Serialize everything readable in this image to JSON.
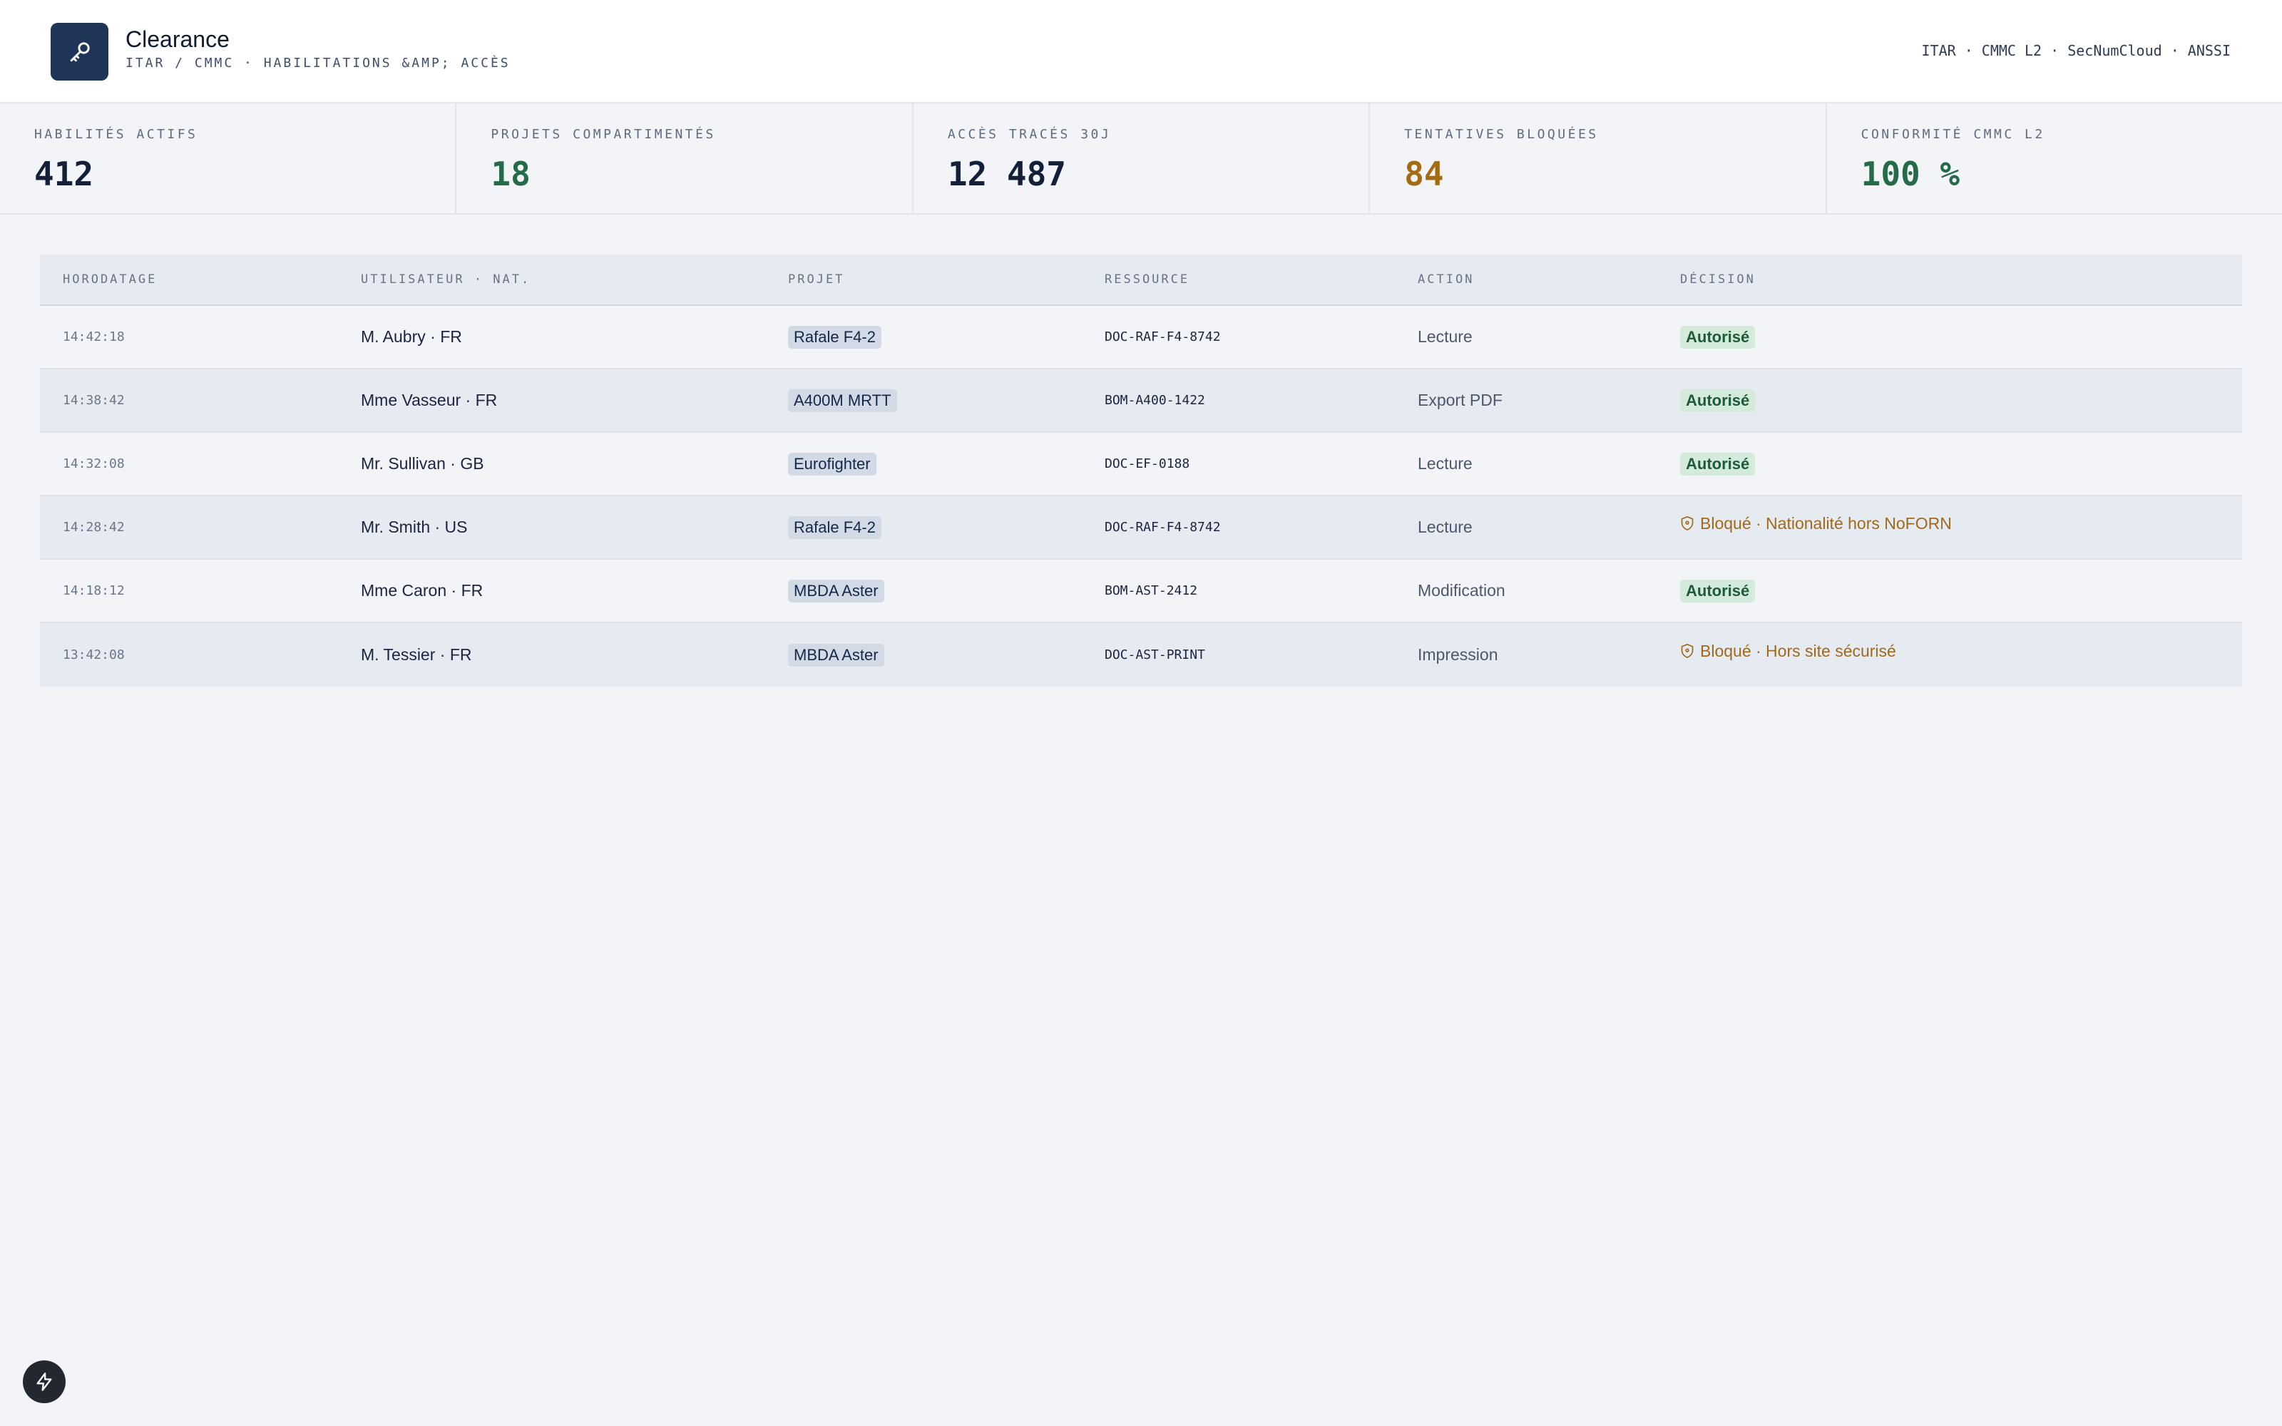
{
  "header": {
    "logo_icon": "key-icon",
    "title": "Clearance",
    "subtitle": "ITAR / CMMC · HABILITATIONS &AMP; ACCÈS",
    "compliance": "ITAR · CMMC L2 · SecNumCloud · ANSSI"
  },
  "kpis": [
    {
      "label": "HABILITÉS ACTIFS",
      "value": "412",
      "color": "#14203a"
    },
    {
      "label": "PROJETS COMPARTIMENTÉS",
      "value": "18",
      "color": "#256b47"
    },
    {
      "label": "ACCÈS TRACÉS 30J",
      "value": "12 487",
      "color": "#14203a"
    },
    {
      "label": "TENTATIVES BLOQUÉES",
      "value": "84",
      "color": "#a46c12"
    },
    {
      "label": "CONFORMITÉ CMMC L2",
      "value": "100 %",
      "color": "#256b47"
    }
  ],
  "table": {
    "columns": [
      "HORODATAGE",
      "UTILISATEUR · NAT.",
      "PROJET",
      "RESSOURCE",
      "ACTION",
      "DÉCISION"
    ],
    "rows": [
      {
        "time": "14:42:18",
        "user": "M. Aubry · FR",
        "project": "Rafale F4-2",
        "resource": "DOC-RAF-F4-8742",
        "action": "Lecture",
        "status": "ok",
        "decision": "Autorisé"
      },
      {
        "time": "14:38:42",
        "user": "Mme Vasseur · FR",
        "project": "A400M MRTT",
        "resource": "BOM-A400-1422",
        "action": "Export PDF",
        "status": "ok",
        "decision": "Autorisé"
      },
      {
        "time": "14:32:08",
        "user": "Mr. Sullivan · GB",
        "project": "Eurofighter",
        "resource": "DOC-EF-0188",
        "action": "Lecture",
        "status": "ok",
        "decision": "Autorisé"
      },
      {
        "time": "14:28:42",
        "user": "Mr. Smith · US",
        "project": "Rafale F4-2",
        "resource": "DOC-RAF-F4-8742",
        "action": "Lecture",
        "status": "blocked",
        "decision": "Bloqué · Nationalité hors NoFORN"
      },
      {
        "time": "14:18:12",
        "user": "Mme Caron · FR",
        "project": "MBDA Aster",
        "resource": "BOM-AST-2412",
        "action": "Modification",
        "status": "ok",
        "decision": "Autorisé"
      },
      {
        "time": "13:42:08",
        "user": "M. Tessier · FR",
        "project": "MBDA Aster",
        "resource": "DOC-AST-PRINT",
        "action": "Impression",
        "status": "blocked",
        "decision": "Bloqué · Hors site sécurisé"
      }
    ]
  },
  "fab": {
    "icon": "lightning-icon"
  }
}
